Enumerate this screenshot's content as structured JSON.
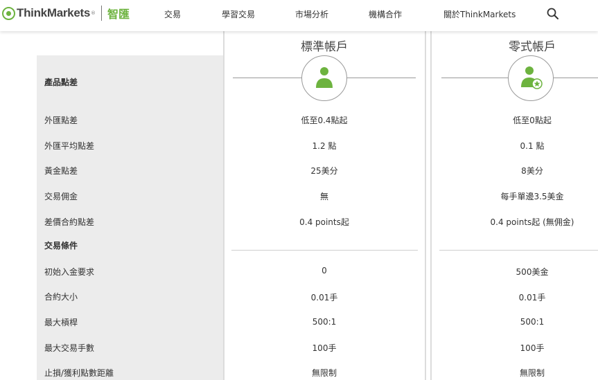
{
  "brand": {
    "name": "ThinkMarkets",
    "tm": "®",
    "chinese": "智匯",
    "accent": "#6db33f"
  },
  "nav": [
    {
      "label": "交易"
    },
    {
      "label": "學習交易"
    },
    {
      "label": "市場分析"
    },
    {
      "label": "機構合作"
    },
    {
      "label": "關於ThinkMarkets"
    }
  ],
  "accounts": [
    {
      "title": "標準帳戶",
      "icon": "user-icon"
    },
    {
      "title": "零式帳戶",
      "icon": "user-star-icon"
    }
  ],
  "sections": {
    "spreads": "產品點差",
    "conditions": "交易條件"
  },
  "rows": [
    {
      "label": "外匯點差",
      "standard": "低至0.4點起",
      "zero": "低至0點起"
    },
    {
      "label": "外匯平均點差",
      "standard": "1.2 點",
      "zero": "0.1 點"
    },
    {
      "label": "黃金點差",
      "standard": "25美分",
      "zero": "8美分"
    },
    {
      "label": "交易佣金",
      "standard": "無",
      "zero": "每手單邊3.5美金"
    },
    {
      "label": "差價合約點差",
      "standard": "0.4 points起",
      "zero": "0.4 points起 (無佣金)"
    },
    {
      "label": "初始入金要求",
      "standard": "0",
      "zero": "500美金"
    },
    {
      "label": "合約大小",
      "standard": "0.01手",
      "zero": "0.01手"
    },
    {
      "label": "最大槓桿",
      "standard": "500:1",
      "zero": "500:1"
    },
    {
      "label": "最大交易手數",
      "standard": "100手",
      "zero": "100手"
    },
    {
      "label": "止損/獲利點數距離",
      "standard": "無限制",
      "zero": "無限制"
    }
  ]
}
